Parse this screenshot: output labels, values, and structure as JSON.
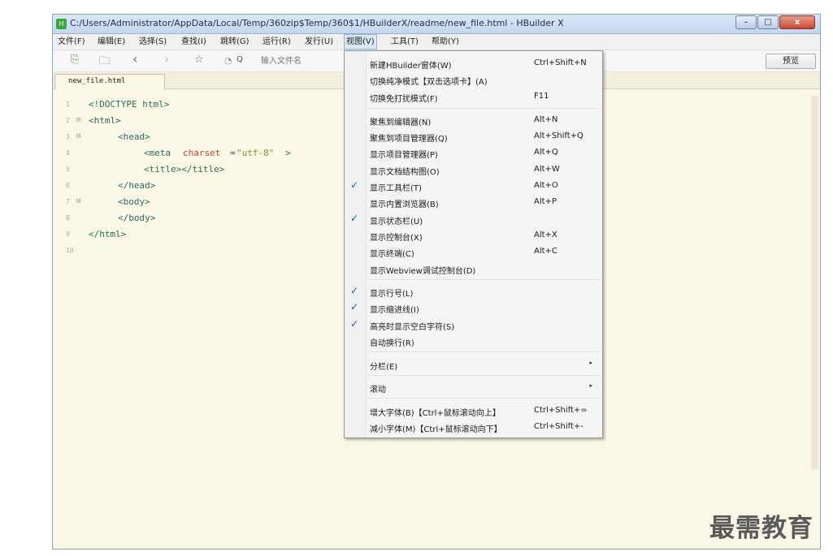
{
  "window": {
    "title": "C:/Users/Administrator/AppData/Local/Temp/360zip$Temp/360$1/HBuilderX/readme/new_file.html - HBuilder X",
    "app_icon": "H",
    "minimize": "–",
    "maximize": "□",
    "close": "x"
  },
  "menubar": [
    {
      "label": "文件(F)"
    },
    {
      "label": "编辑(E)"
    },
    {
      "label": "选择(S)"
    },
    {
      "label": "查找(I)"
    },
    {
      "label": "跳转(G)"
    },
    {
      "label": "运行(R)"
    },
    {
      "label": "发行(U)"
    },
    {
      "label": "视图(V)"
    },
    {
      "label": "工具(T)"
    },
    {
      "label": "帮助(Y)"
    }
  ],
  "toolbar": {
    "search_placeholder": "输入文件名",
    "preview_label": "预览",
    "icons": {
      "new": "⎘",
      "save": "🗀",
      "back": "‹",
      "forward": "›",
      "star": "☆",
      "history": "◔",
      "search": "Q"
    }
  },
  "tab": {
    "label": "new_file.html"
  },
  "editor": {
    "lines": [
      {
        "num": "1",
        "fold": ""
      },
      {
        "num": "2",
        "fold": "⊟"
      },
      {
        "num": "3",
        "fold": "⊟"
      },
      {
        "num": "4",
        "fold": ""
      },
      {
        "num": "5",
        "fold": ""
      },
      {
        "num": "6",
        "fold": ""
      },
      {
        "num": "7",
        "fold": "⊟"
      },
      {
        "num": "8",
        "fold": ""
      },
      {
        "num": "9",
        "fold": ""
      },
      {
        "num": "10",
        "fold": ""
      }
    ],
    "code": {
      "l1": "<!DOCTYPE html>",
      "l2": "<html>",
      "l3": "<head>",
      "l4_tag": "<meta",
      "l4_attr": "charset",
      "l4_eq": "=",
      "l4_val": "\"utf-8\"",
      "l4_end": ">",
      "l5": "<title></title>",
      "l6": "</head>",
      "l7": "<body>",
      "l8": "</body>",
      "l9": "</html>"
    }
  },
  "view_menu": {
    "items": [
      {
        "label": "新建HBuilder窗体(W)",
        "shortcut": "Ctrl+Shift+N",
        "checked": ""
      },
      {
        "label": "切换纯净模式【双击选项卡】(A)",
        "shortcut": "",
        "checked": ""
      },
      {
        "label": "切换免打扰模式(F)",
        "shortcut": "F11",
        "checked": ""
      },
      {
        "label": "聚焦到编辑器(N)",
        "shortcut": "Alt+N",
        "checked": ""
      },
      {
        "label": "聚焦到项目管理器(Q)",
        "shortcut": "Alt+Shift+Q",
        "checked": ""
      },
      {
        "label": "显示项目管理器(P)",
        "shortcut": "Alt+Q",
        "checked": ""
      },
      {
        "label": "显示文档结构图(O)",
        "shortcut": "Alt+W",
        "checked": ""
      },
      {
        "label": "显示工具栏(T)",
        "shortcut": "Alt+O",
        "checked": "✓"
      },
      {
        "label": "显示内置浏览器(B)",
        "shortcut": "Alt+P",
        "checked": ""
      },
      {
        "label": "显示状态栏(U)",
        "shortcut": "",
        "checked": "✓"
      },
      {
        "label": "显示控制台(X)",
        "shortcut": "Alt+X",
        "checked": ""
      },
      {
        "label": "显示终端(C)",
        "shortcut": "Alt+C",
        "checked": ""
      },
      {
        "label": "显示Webview调试控制台(D)",
        "shortcut": "",
        "checked": ""
      },
      {
        "label": "显示行号(L)",
        "shortcut": "",
        "checked": "✓"
      },
      {
        "label": "显示缩进线(I)",
        "shortcut": "",
        "checked": "✓"
      },
      {
        "label": "高亮时显示空白字符(S)",
        "shortcut": "",
        "checked": "✓"
      },
      {
        "label": "自动换行(R)",
        "shortcut": "",
        "checked": ""
      },
      {
        "label": "分栏(E)",
        "shortcut": "",
        "checked": "",
        "arrow": "▸"
      },
      {
        "label": "滚动",
        "shortcut": "",
        "checked": "",
        "arrow": "▸"
      },
      {
        "label": "增大字体(B)【Ctrl+鼠标滚动向上】",
        "shortcut": "Ctrl+Shift+=",
        "checked": ""
      },
      {
        "label": "减小字体(M)【Ctrl+鼠标滚动向下】",
        "shortcut": "Ctrl+Shift+-",
        "checked": ""
      }
    ]
  },
  "watermark": "最需教育"
}
